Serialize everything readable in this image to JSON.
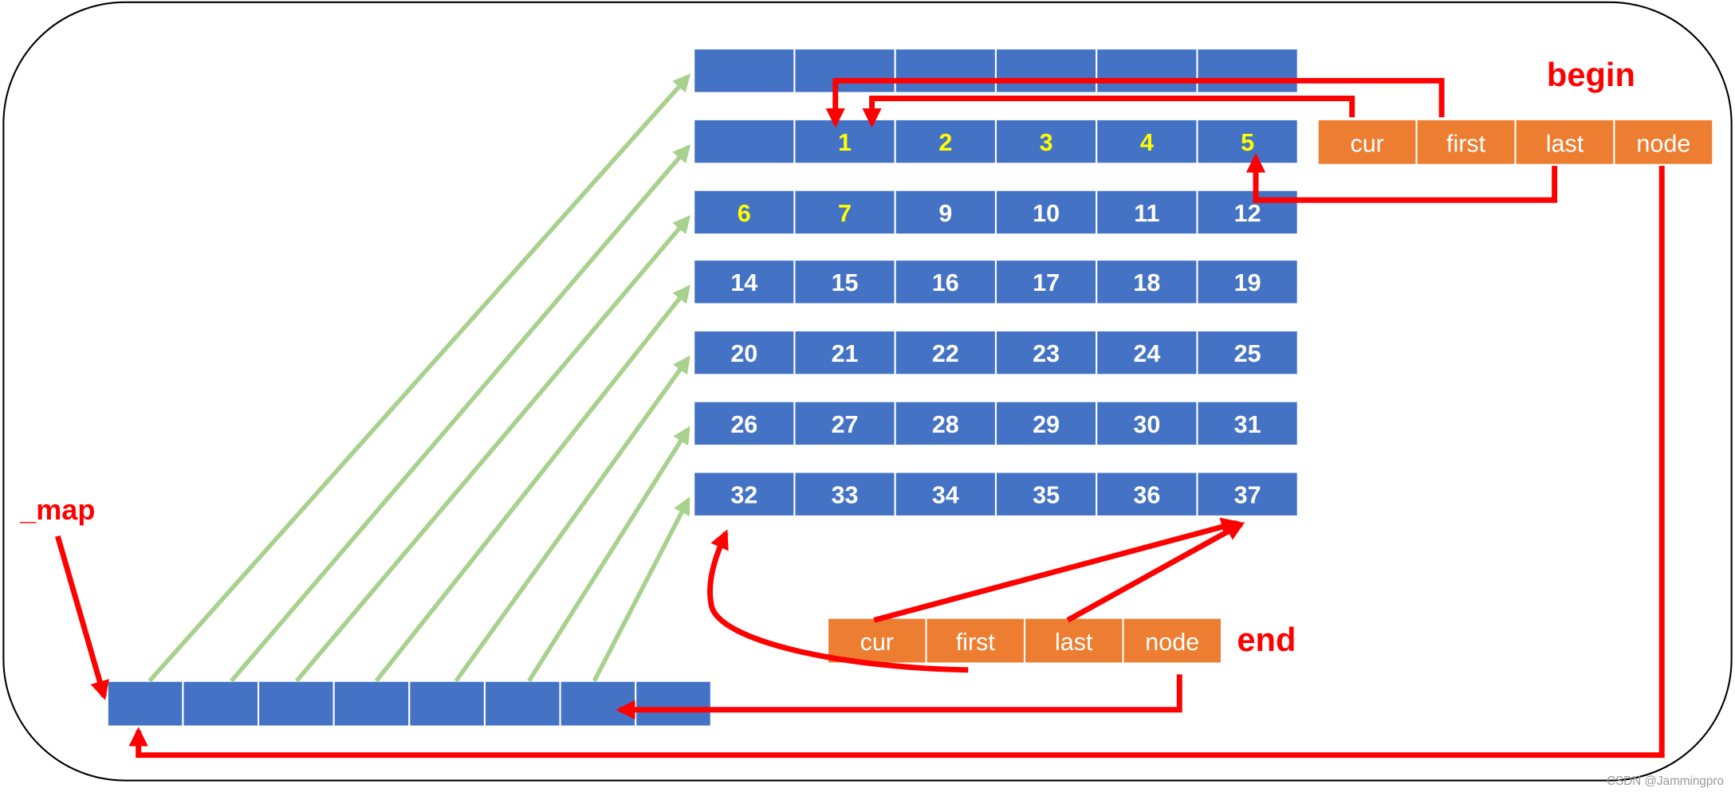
{
  "labels": {
    "begin": "begin",
    "end": "end",
    "map": "_map"
  },
  "iterator_fields": [
    "cur",
    "first",
    "last",
    "node"
  ],
  "buffer_rows": [
    [
      "",
      "",
      "",
      "",
      "",
      ""
    ],
    [
      "",
      "1",
      "2",
      "3",
      "4",
      "5"
    ],
    [
      "6",
      "7",
      "9",
      "10",
      "11",
      "12"
    ],
    [
      "14",
      "15",
      "16",
      "17",
      "18",
      "19"
    ],
    [
      "20",
      "21",
      "22",
      "23",
      "24",
      "25"
    ],
    [
      "26",
      "27",
      "28",
      "29",
      "30",
      "31"
    ],
    [
      "32",
      "33",
      "34",
      "35",
      "36",
      "37"
    ]
  ],
  "highlighted_values": [
    "1",
    "2",
    "3",
    "4",
    "5",
    "6",
    "7"
  ],
  "map_cell_count": 8,
  "watermark": "CSDN @Jammingpro",
  "colors": {
    "buffer": "#4472c4",
    "iterator": "#ed7d31",
    "pointer": "#ff0000",
    "map_link": "#a9d18e",
    "highlight": "#ffff00"
  }
}
